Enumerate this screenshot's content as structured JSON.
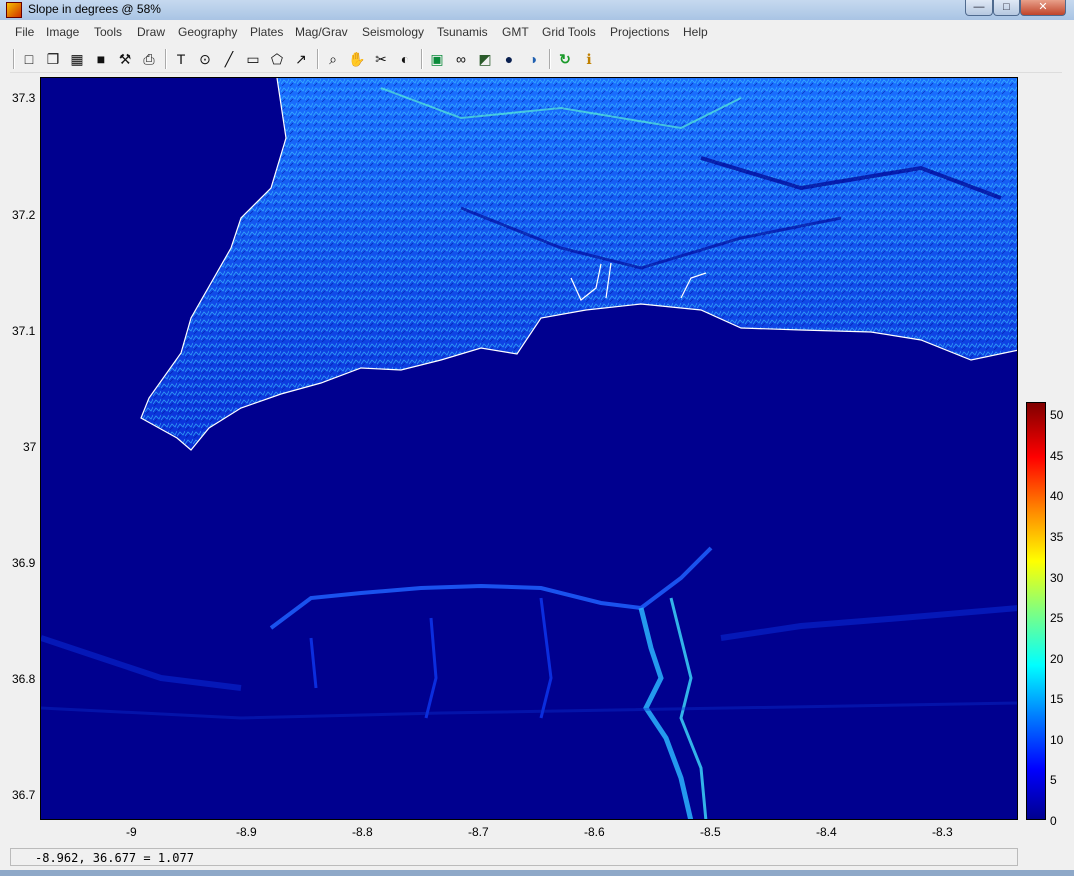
{
  "window": {
    "title": "Slope in degrees  @  58%",
    "controls": {
      "minimize": "—",
      "maximize": "□",
      "close": "✕"
    }
  },
  "menubar": [
    "File",
    "Image",
    "Tools",
    "Draw",
    "Geography",
    "Plates",
    "Mag/Grav",
    "Seismology",
    "Tsunamis",
    "GMT",
    "Grid Tools",
    "Projections",
    "Help"
  ],
  "toolbar": {
    "buttons": [
      {
        "name": "new-file-icon",
        "glyph": "□"
      },
      {
        "name": "open-folder-icon",
        "glyph": "❐"
      },
      {
        "name": "image-icon",
        "glyph": "▦"
      },
      {
        "name": "save-icon",
        "glyph": "■"
      },
      {
        "name": "tools-icon",
        "glyph": "⚒"
      },
      {
        "name": "print-icon",
        "glyph": "⎙"
      },
      {
        "name": "text-icon",
        "glyph": "T"
      },
      {
        "name": "circle-icon",
        "glyph": "⊙"
      },
      {
        "name": "line-icon",
        "glyph": "╱"
      },
      {
        "name": "rectangle-icon",
        "glyph": "▭"
      },
      {
        "name": "polygon-icon",
        "glyph": "⬠"
      },
      {
        "name": "arrow-icon",
        "glyph": "↗"
      },
      {
        "name": "zoom-icon",
        "glyph": "⌕"
      },
      {
        "name": "pan-hand-icon",
        "glyph": "✋"
      },
      {
        "name": "cut-icon",
        "glyph": "✂"
      },
      {
        "name": "color-palette-icon",
        "glyph": "◐"
      },
      {
        "name": "map-icon",
        "glyph": "▣"
      },
      {
        "name": "binoculars-icon",
        "glyph": "∞"
      },
      {
        "name": "terrain-icon",
        "glyph": "◩"
      },
      {
        "name": "globe-dark-icon",
        "glyph": "●"
      },
      {
        "name": "globe-icon",
        "glyph": "◑"
      },
      {
        "name": "refresh-icon",
        "glyph": "↻"
      },
      {
        "name": "info-icon",
        "glyph": "ℹ"
      }
    ]
  },
  "map": {
    "x_ticks": [
      "-9",
      "-8.9",
      "-8.8",
      "-8.7",
      "-8.6",
      "-8.5",
      "-8.4",
      "-8.3"
    ],
    "y_ticks": [
      "37.3",
      "37.2",
      "37.1",
      "37",
      "36.9",
      "36.8",
      "36.7"
    ]
  },
  "colorbar": {
    "ticks": [
      "50",
      "45",
      "40",
      "35",
      "30",
      "25",
      "20",
      "15",
      "10",
      "5",
      "0"
    ],
    "colors": [
      "#00008f",
      "#0000ff",
      "#0080ff",
      "#00ffff",
      "#80ff80",
      "#ffff00",
      "#ff8000",
      "#ff0000",
      "#800000"
    ]
  },
  "status": {
    "readout": "-8.962, 36.677 =  1.077"
  }
}
